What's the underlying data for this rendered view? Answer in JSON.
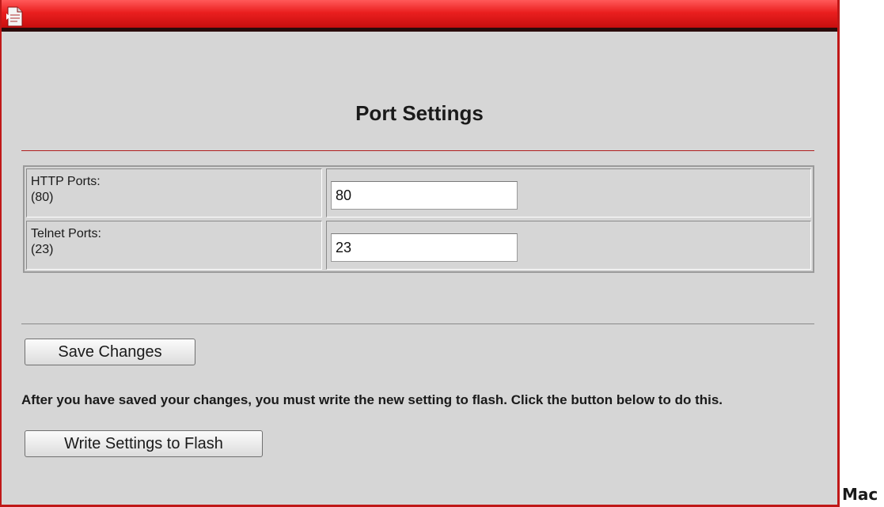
{
  "page": {
    "title": "Port Settings"
  },
  "ports": {
    "http": {
      "label": "HTTP Ports:",
      "default": "(80)",
      "value": "80"
    },
    "telnet": {
      "label": "Telnet Ports:",
      "default": "(23)",
      "value": "23"
    }
  },
  "actions": {
    "save_label": "Save Changes",
    "notice": "After you have saved your changes, you must write the new setting to flash. Click the button below to do this.",
    "flash_label": "Write Settings to Flash"
  },
  "outside": {
    "text": "Mac"
  },
  "icons": {
    "titlebar": "page-icon"
  },
  "colors": {
    "titlebar": "#e01a1a",
    "frame_border": "#c01818",
    "background": "#d6d6d6",
    "title_rule": "#b02020"
  }
}
